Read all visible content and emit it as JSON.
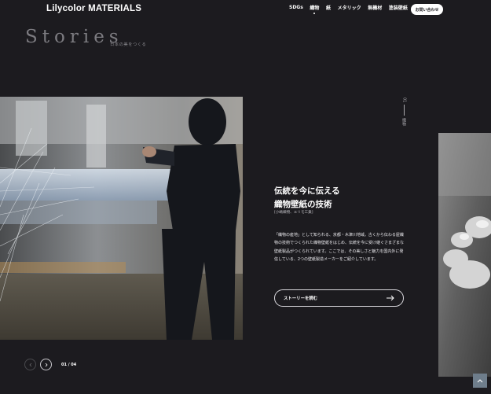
{
  "header": {
    "brand": "Lilycolor MATERIALS",
    "nav": [
      {
        "label": "SDGs",
        "active": false
      },
      {
        "label": "織物",
        "active": true
      },
      {
        "label": "紙",
        "active": false
      },
      {
        "label": "メタリック",
        "active": false
      },
      {
        "label": "無機材",
        "active": false
      },
      {
        "label": "塗装壁紙",
        "active": false
      }
    ],
    "contact_label": "お問い合わせ"
  },
  "section": {
    "title": "Stories",
    "subtitle": "日本の美をつくる"
  },
  "slide": {
    "index_label": "01",
    "category": "織物",
    "heading_line1": "伝統を今に伝える",
    "heading_line2": "織物壁紙の技術",
    "company": "[小嶋織物、エリモ工業]",
    "description": "「織物の産地」として知られる、京都・木津川地域。古くから伝わる屋織物の技術でつくられた織物壁紙をはじめ、伝統を今に受け継ぐさまざまな壁紙製品がつくられています。ここでは、その美しさと魅力を国内外に発信している、2つの壁紙製造メーカーをご紹介しています。",
    "button_label": "ストーリーを読む"
  },
  "pager": {
    "current": "01",
    "separator": " / ",
    "total": "04"
  },
  "icons": {
    "prev": "chevron-left-icon",
    "next": "chevron-right-icon",
    "read_more": "arrow-right-icon",
    "scroll_top": "chevron-up-icon"
  }
}
